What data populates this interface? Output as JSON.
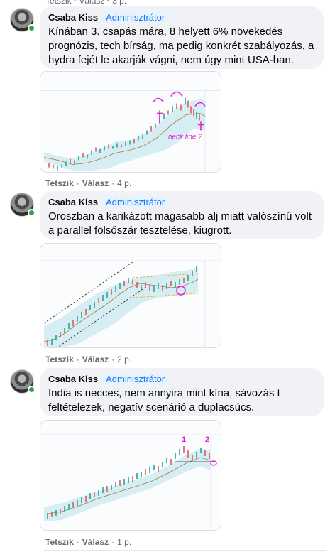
{
  "top_actions": {
    "like": "Tetszik",
    "reply": "Válasz",
    "time": "3 p."
  },
  "colors": {
    "online": "#31a24c",
    "badge": "#1877f2",
    "bubble": "#f0f2f5",
    "annotation": "#e31fd7"
  },
  "comments": [
    {
      "author": "Csaba Kiss",
      "badge": "Adminisztrátor",
      "text": "Kínában 3. csapás mára, 8 helyett 6% növekedés prognózis, tech bírság, ma pedig konkrét szabályozás, a hydra fejét le akarják vágni, nem úgy mint USA-ban.",
      "chart_annotation": "neck line ?",
      "like": "Tetszik",
      "reply": "Válasz",
      "time": "4 p."
    },
    {
      "author": "Csaba Kiss",
      "badge": "Adminisztrátor",
      "text": "Oroszban a karikázott magasabb alj miatt valószínű volt a parallel fölsőszár tesztelése, kiugrott.",
      "like": "Tetszik",
      "reply": "Válasz",
      "time": "2 p."
    },
    {
      "author": "Csaba Kiss",
      "badge": "Adminisztrátor",
      "text": "India is necces, nem annyira mint kína, sávozás t feltételezek, negatív scenárió a duplacsúcs.",
      "chart_labels": [
        "1",
        "2"
      ],
      "like": "Tetszik",
      "reply": "Válasz",
      "time": "1 p."
    }
  ]
}
